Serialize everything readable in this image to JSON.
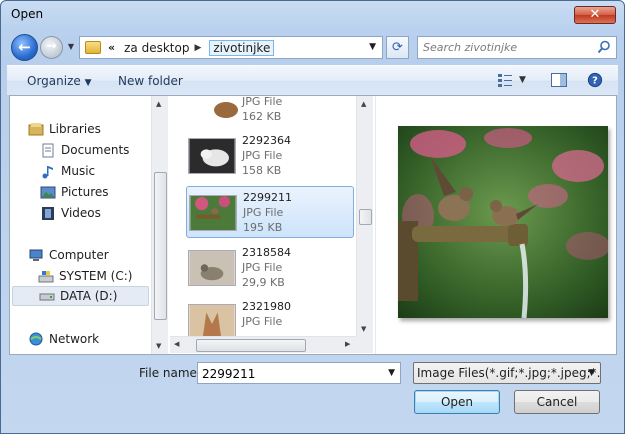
{
  "window": {
    "title": "Open",
    "close_glyph": "✕"
  },
  "address": {
    "overflow_glyph": "«",
    "crumbs": [
      "za desktop",
      "zivotinjke"
    ]
  },
  "search": {
    "placeholder": "Search zivotinjke"
  },
  "toolbar": {
    "organize_label": "Organize",
    "new_folder_label": "New folder"
  },
  "nav": {
    "items": [
      {
        "label": "Libraries",
        "icon": "libraries-icon"
      },
      {
        "label": "Documents",
        "icon": "documents-icon"
      },
      {
        "label": "Music",
        "icon": "music-icon"
      },
      {
        "label": "Pictures",
        "icon": "pictures-icon"
      },
      {
        "label": "Videos",
        "icon": "videos-icon"
      },
      {
        "label": "Computer",
        "icon": "computer-icon"
      },
      {
        "label": "SYSTEM (C:)",
        "icon": "system-drive-icon"
      },
      {
        "label": "DATA (D:)",
        "icon": "data-drive-icon",
        "selected": true
      },
      {
        "label": "Network",
        "icon": "network-icon"
      }
    ]
  },
  "files": [
    {
      "name": "",
      "type": "JPG File",
      "size": "162 KB"
    },
    {
      "name": "2292364",
      "type": "JPG File",
      "size": "158 KB"
    },
    {
      "name": "2299211",
      "type": "JPG File",
      "size": "195 KB",
      "selected": true
    },
    {
      "name": "2318584",
      "type": "JPG File",
      "size": "29,9 KB"
    },
    {
      "name": "2321980",
      "type": "JPG File",
      "size": ""
    }
  ],
  "footer": {
    "file_name_label": "File name:",
    "file_name_value": "2299211",
    "filter_value": "Image Files(*.gif;*.jpg;*.jpeg;*.b",
    "open_label": "Open",
    "cancel_label": "Cancel"
  },
  "colors": {
    "accent": "#3c7fb1",
    "selection": "#cde4fb",
    "close": "#c2391f"
  }
}
